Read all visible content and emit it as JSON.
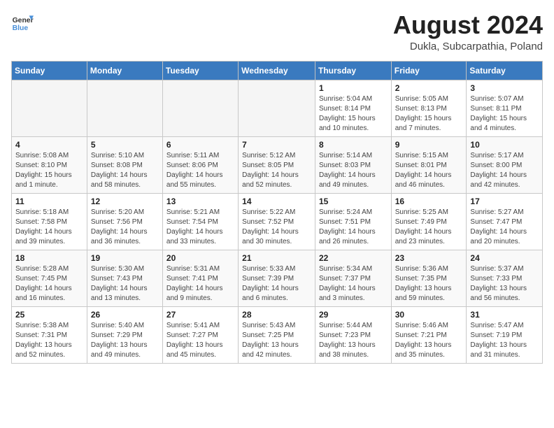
{
  "header": {
    "logo_line1": "General",
    "logo_line2": "Blue",
    "month_year": "August 2024",
    "location": "Dukla, Subcarpathia, Poland"
  },
  "weekdays": [
    "Sunday",
    "Monday",
    "Tuesday",
    "Wednesday",
    "Thursday",
    "Friday",
    "Saturday"
  ],
  "weeks": [
    [
      {
        "day": "",
        "info": ""
      },
      {
        "day": "",
        "info": ""
      },
      {
        "day": "",
        "info": ""
      },
      {
        "day": "",
        "info": ""
      },
      {
        "day": "1",
        "info": "Sunrise: 5:04 AM\nSunset: 8:14 PM\nDaylight: 15 hours\nand 10 minutes."
      },
      {
        "day": "2",
        "info": "Sunrise: 5:05 AM\nSunset: 8:13 PM\nDaylight: 15 hours\nand 7 minutes."
      },
      {
        "day": "3",
        "info": "Sunrise: 5:07 AM\nSunset: 8:11 PM\nDaylight: 15 hours\nand 4 minutes."
      }
    ],
    [
      {
        "day": "4",
        "info": "Sunrise: 5:08 AM\nSunset: 8:10 PM\nDaylight: 15 hours\nand 1 minute."
      },
      {
        "day": "5",
        "info": "Sunrise: 5:10 AM\nSunset: 8:08 PM\nDaylight: 14 hours\nand 58 minutes."
      },
      {
        "day": "6",
        "info": "Sunrise: 5:11 AM\nSunset: 8:06 PM\nDaylight: 14 hours\nand 55 minutes."
      },
      {
        "day": "7",
        "info": "Sunrise: 5:12 AM\nSunset: 8:05 PM\nDaylight: 14 hours\nand 52 minutes."
      },
      {
        "day": "8",
        "info": "Sunrise: 5:14 AM\nSunset: 8:03 PM\nDaylight: 14 hours\nand 49 minutes."
      },
      {
        "day": "9",
        "info": "Sunrise: 5:15 AM\nSunset: 8:01 PM\nDaylight: 14 hours\nand 46 minutes."
      },
      {
        "day": "10",
        "info": "Sunrise: 5:17 AM\nSunset: 8:00 PM\nDaylight: 14 hours\nand 42 minutes."
      }
    ],
    [
      {
        "day": "11",
        "info": "Sunrise: 5:18 AM\nSunset: 7:58 PM\nDaylight: 14 hours\nand 39 minutes."
      },
      {
        "day": "12",
        "info": "Sunrise: 5:20 AM\nSunset: 7:56 PM\nDaylight: 14 hours\nand 36 minutes."
      },
      {
        "day": "13",
        "info": "Sunrise: 5:21 AM\nSunset: 7:54 PM\nDaylight: 14 hours\nand 33 minutes."
      },
      {
        "day": "14",
        "info": "Sunrise: 5:22 AM\nSunset: 7:52 PM\nDaylight: 14 hours\nand 30 minutes."
      },
      {
        "day": "15",
        "info": "Sunrise: 5:24 AM\nSunset: 7:51 PM\nDaylight: 14 hours\nand 26 minutes."
      },
      {
        "day": "16",
        "info": "Sunrise: 5:25 AM\nSunset: 7:49 PM\nDaylight: 14 hours\nand 23 minutes."
      },
      {
        "day": "17",
        "info": "Sunrise: 5:27 AM\nSunset: 7:47 PM\nDaylight: 14 hours\nand 20 minutes."
      }
    ],
    [
      {
        "day": "18",
        "info": "Sunrise: 5:28 AM\nSunset: 7:45 PM\nDaylight: 14 hours\nand 16 minutes."
      },
      {
        "day": "19",
        "info": "Sunrise: 5:30 AM\nSunset: 7:43 PM\nDaylight: 14 hours\nand 13 minutes."
      },
      {
        "day": "20",
        "info": "Sunrise: 5:31 AM\nSunset: 7:41 PM\nDaylight: 14 hours\nand 9 minutes."
      },
      {
        "day": "21",
        "info": "Sunrise: 5:33 AM\nSunset: 7:39 PM\nDaylight: 14 hours\nand 6 minutes."
      },
      {
        "day": "22",
        "info": "Sunrise: 5:34 AM\nSunset: 7:37 PM\nDaylight: 14 hours\nand 3 minutes."
      },
      {
        "day": "23",
        "info": "Sunrise: 5:36 AM\nSunset: 7:35 PM\nDaylight: 13 hours\nand 59 minutes."
      },
      {
        "day": "24",
        "info": "Sunrise: 5:37 AM\nSunset: 7:33 PM\nDaylight: 13 hours\nand 56 minutes."
      }
    ],
    [
      {
        "day": "25",
        "info": "Sunrise: 5:38 AM\nSunset: 7:31 PM\nDaylight: 13 hours\nand 52 minutes."
      },
      {
        "day": "26",
        "info": "Sunrise: 5:40 AM\nSunset: 7:29 PM\nDaylight: 13 hours\nand 49 minutes."
      },
      {
        "day": "27",
        "info": "Sunrise: 5:41 AM\nSunset: 7:27 PM\nDaylight: 13 hours\nand 45 minutes."
      },
      {
        "day": "28",
        "info": "Sunrise: 5:43 AM\nSunset: 7:25 PM\nDaylight: 13 hours\nand 42 minutes."
      },
      {
        "day": "29",
        "info": "Sunrise: 5:44 AM\nSunset: 7:23 PM\nDaylight: 13 hours\nand 38 minutes."
      },
      {
        "day": "30",
        "info": "Sunrise: 5:46 AM\nSunset: 7:21 PM\nDaylight: 13 hours\nand 35 minutes."
      },
      {
        "day": "31",
        "info": "Sunrise: 5:47 AM\nSunset: 7:19 PM\nDaylight: 13 hours\nand 31 minutes."
      }
    ]
  ]
}
